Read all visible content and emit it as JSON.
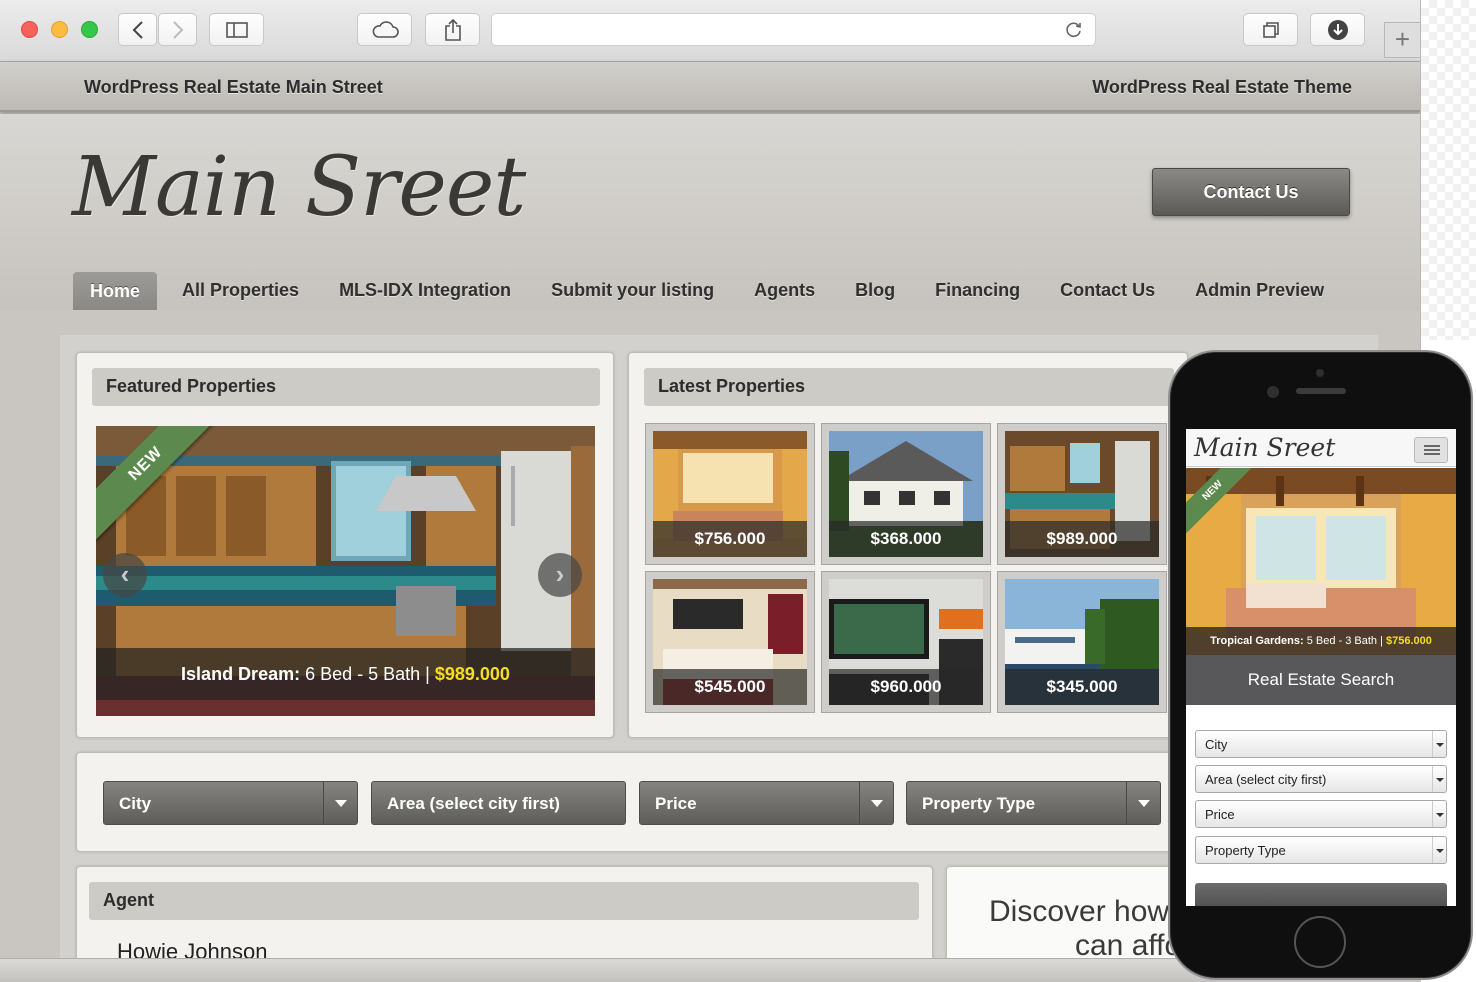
{
  "browser": {
    "address_value": "",
    "new_tab_label": "+"
  },
  "site": {
    "top_left": "WordPress Real Estate Main Street",
    "top_right": "WordPress Real Estate Theme",
    "logo_text": "Main Sreet",
    "contact_button": "Contact Us",
    "nav": [
      "Home",
      "All Properties",
      "MLS-IDX Integration",
      "Submit your listing",
      "Agents",
      "Blog",
      "Financing",
      "Contact Us",
      "Admin Preview"
    ],
    "active_nav": "Home"
  },
  "featured": {
    "heading": "Featured Properties",
    "badge": "NEW",
    "caption_title": "Island Dream:",
    "caption_details": " 6 Bed - 5 Bath | ",
    "caption_price": "$989.000"
  },
  "latest": {
    "heading": "Latest Properties",
    "prices": [
      "$756.000",
      "$368.000",
      "$989.000",
      "$545.000",
      "$960.000",
      "$345.000"
    ]
  },
  "search": {
    "city": "City",
    "area": "Area (select city first)",
    "price": "Price",
    "type": "Property Type"
  },
  "agent": {
    "heading": "Agent",
    "name": "Howie Johnson"
  },
  "discover": {
    "line1": "Discover how",
    "line2": "can affo"
  },
  "mobile": {
    "logo_text": "Main Sreet",
    "badge": "NEW",
    "caption_title": "Tropical Gardens:",
    "caption_details": " 5 Bed - 3 Bath | ",
    "caption_price": "$756.000",
    "search_title": "Real Estate Search",
    "city": "City",
    "area": "Area (select city first)",
    "price": "Price",
    "type": "Property Type"
  },
  "colors": {
    "accent_yellow": "#f5dd23",
    "ribbon_green": "#5c8a4e",
    "nav_active": "#8f8d89"
  }
}
